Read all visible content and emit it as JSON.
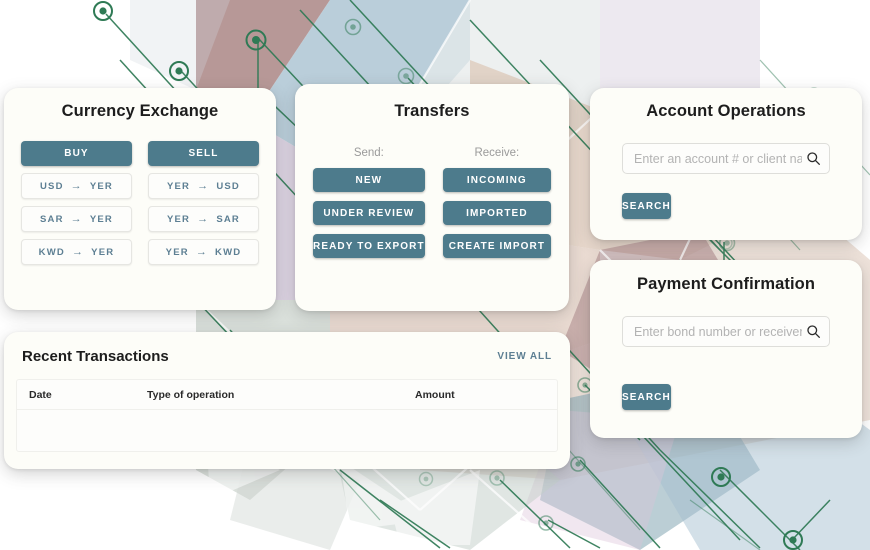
{
  "theme": {
    "primary_button": "#4D7B8C",
    "link": "#5D7F93",
    "card_background": "#FDFDF8",
    "page_background": "#FFFFFF",
    "circuit_green": "#2F7A55"
  },
  "currency_exchange": {
    "title": "Currency Exchange",
    "buy_label": "BUY",
    "sell_label": "SELL",
    "buy_pairs": [
      {
        "from": "USD",
        "arrow": "→",
        "to": "YER"
      },
      {
        "from": "SAR",
        "arrow": "→",
        "to": "YER"
      },
      {
        "from": "KWD",
        "arrow": "→",
        "to": "YER"
      }
    ],
    "sell_pairs": [
      {
        "from": "YER",
        "arrow": "→",
        "to": "USD"
      },
      {
        "from": "YER",
        "arrow": "→",
        "to": "SAR"
      },
      {
        "from": "YER",
        "arrow": "→",
        "to": "KWD"
      }
    ]
  },
  "transfers": {
    "title": "Transfers",
    "send_label": "Send:",
    "receive_label": "Receive:",
    "send_buttons": [
      "NEW",
      "UNDER REVIEW",
      "READY TO EXPORT"
    ],
    "receive_buttons": [
      "INCOMING",
      "IMPORTED",
      "CREATE IMPORT"
    ]
  },
  "account_operations": {
    "title": "Account Operations",
    "search_placeholder": "Enter an account # or client name",
    "search_value": "",
    "search_icon": "search-icon",
    "search_button": "SEARCH"
  },
  "payment_confirmation": {
    "title": "Payment Confirmation",
    "search_placeholder": "Enter bond number or receiver",
    "search_value": "",
    "search_icon": "search-icon",
    "search_button": "SEARCH"
  },
  "recent_transactions": {
    "title": "Recent Transactions",
    "view_all_label": "VIEW ALL",
    "columns": [
      "Date",
      "Type of operation",
      "Amount"
    ],
    "rows": []
  }
}
